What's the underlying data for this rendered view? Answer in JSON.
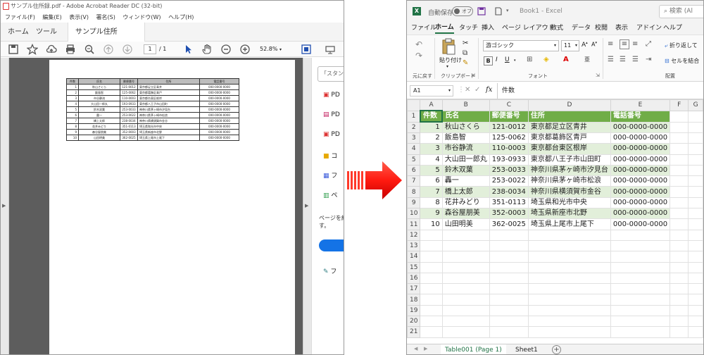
{
  "acrobat": {
    "title": "サンプル住所録.pdf - Adobe Acrobat Reader DC (32-bit)",
    "menu": [
      "ファイル(F)",
      "編集(E)",
      "表示(V)",
      "署名(S)",
      "ウィンドウ(W)",
      "ヘルプ(H)"
    ],
    "tabs": [
      "ホーム",
      "ツール",
      "サンプル住所録.pdf"
    ],
    "tab_close": "×",
    "page_current": "1",
    "page_total": "/ 1",
    "zoom": "52.8%",
    "right_panel": {
      "search_placeholder": "「スタンプ」",
      "items": [
        "PD",
        "PD",
        "PD",
        "コ",
        "フ",
        "ペ"
      ],
      "footer_text": "ページを紙",
      "footer_text2": "す。",
      "last_item": "フ"
    },
    "table": {
      "headers": [
        "件数",
        "氏名",
        "郵便番号",
        "住所",
        "電話番号"
      ],
      "rows": [
        [
          "1",
          "秋山さくら",
          "121-0012",
          "東京都足立区青井",
          "000-0000-0000"
        ],
        [
          "2",
          "飯島智",
          "125-0062",
          "東京都葛飾区青戸",
          "000-0000-0000"
        ],
        [
          "3",
          "市谷静流",
          "110-0003",
          "東京都台東区根岸",
          "000-0000-0000"
        ],
        [
          "4",
          "大山田一郎丸",
          "193-0933",
          "東京都八王子市山田町",
          "000-0000-0000"
        ],
        [
          "5",
          "鈴木双葉",
          "253-0033",
          "神奈川県茅ヶ崎市汐見台",
          "000-0000-0000"
        ],
        [
          "6",
          "轟一",
          "253-0022",
          "神奈川県茅ヶ崎市松浪",
          "000-0000-0000"
        ],
        [
          "7",
          "橋上太郎",
          "238-0034",
          "神奈川県横須賀市金谷",
          "000-0000-0000"
        ],
        [
          "8",
          "花井みどり",
          "351-0113",
          "埼玉県和光市中央",
          "000-0000-0000"
        ],
        [
          "9",
          "森谷屋朋美",
          "352-0003",
          "埼玉県新座市北野",
          "000-0000-0000"
        ],
        [
          "10",
          "山田明美",
          "362-0025",
          "埼玉県上尾市上尾下",
          "000-0000-0000"
        ]
      ]
    }
  },
  "excel": {
    "autosave_label": "自動保存",
    "autosave_state": "オフ",
    "book_title": "Book1 - Excel",
    "search_placeholder": "検索 (Al",
    "ribbon_tabs": [
      "ファイル",
      "ホーム",
      "タッチ",
      "挿入",
      "ページ レイアウト",
      "数式",
      "データ",
      "校閲",
      "表示",
      "アドイン",
      "ヘルプ"
    ],
    "active_tab": "ホーム",
    "groups": {
      "undo": "元に戻す",
      "clipboard": "クリップボード",
      "paste": "貼り付け",
      "font": "フォント",
      "alignment": "配置"
    },
    "font_name": "游ゴシック",
    "font_size": "11",
    "wrap_text": "折り返して",
    "merge_center": "セルを結合",
    "name_box": "A1",
    "formula_value": "件数",
    "fx": "fx",
    "columns": [
      "A",
      "B",
      "C",
      "D",
      "E",
      "F",
      "G"
    ],
    "row_numbers": [
      "1",
      "2",
      "3",
      "4",
      "5",
      "6",
      "7",
      "8",
      "9",
      "10",
      "11",
      "12",
      "13",
      "14",
      "15",
      "16",
      "17",
      "18",
      "19",
      "20",
      "21"
    ],
    "sheet_tabs": [
      "Table001 (Page 1)",
      "Sheet1"
    ],
    "active_sheet": "Table001 (Page 1)",
    "table_header_color": "#70ad47",
    "band_color": "#e2efda",
    "accent": "#217346"
  }
}
